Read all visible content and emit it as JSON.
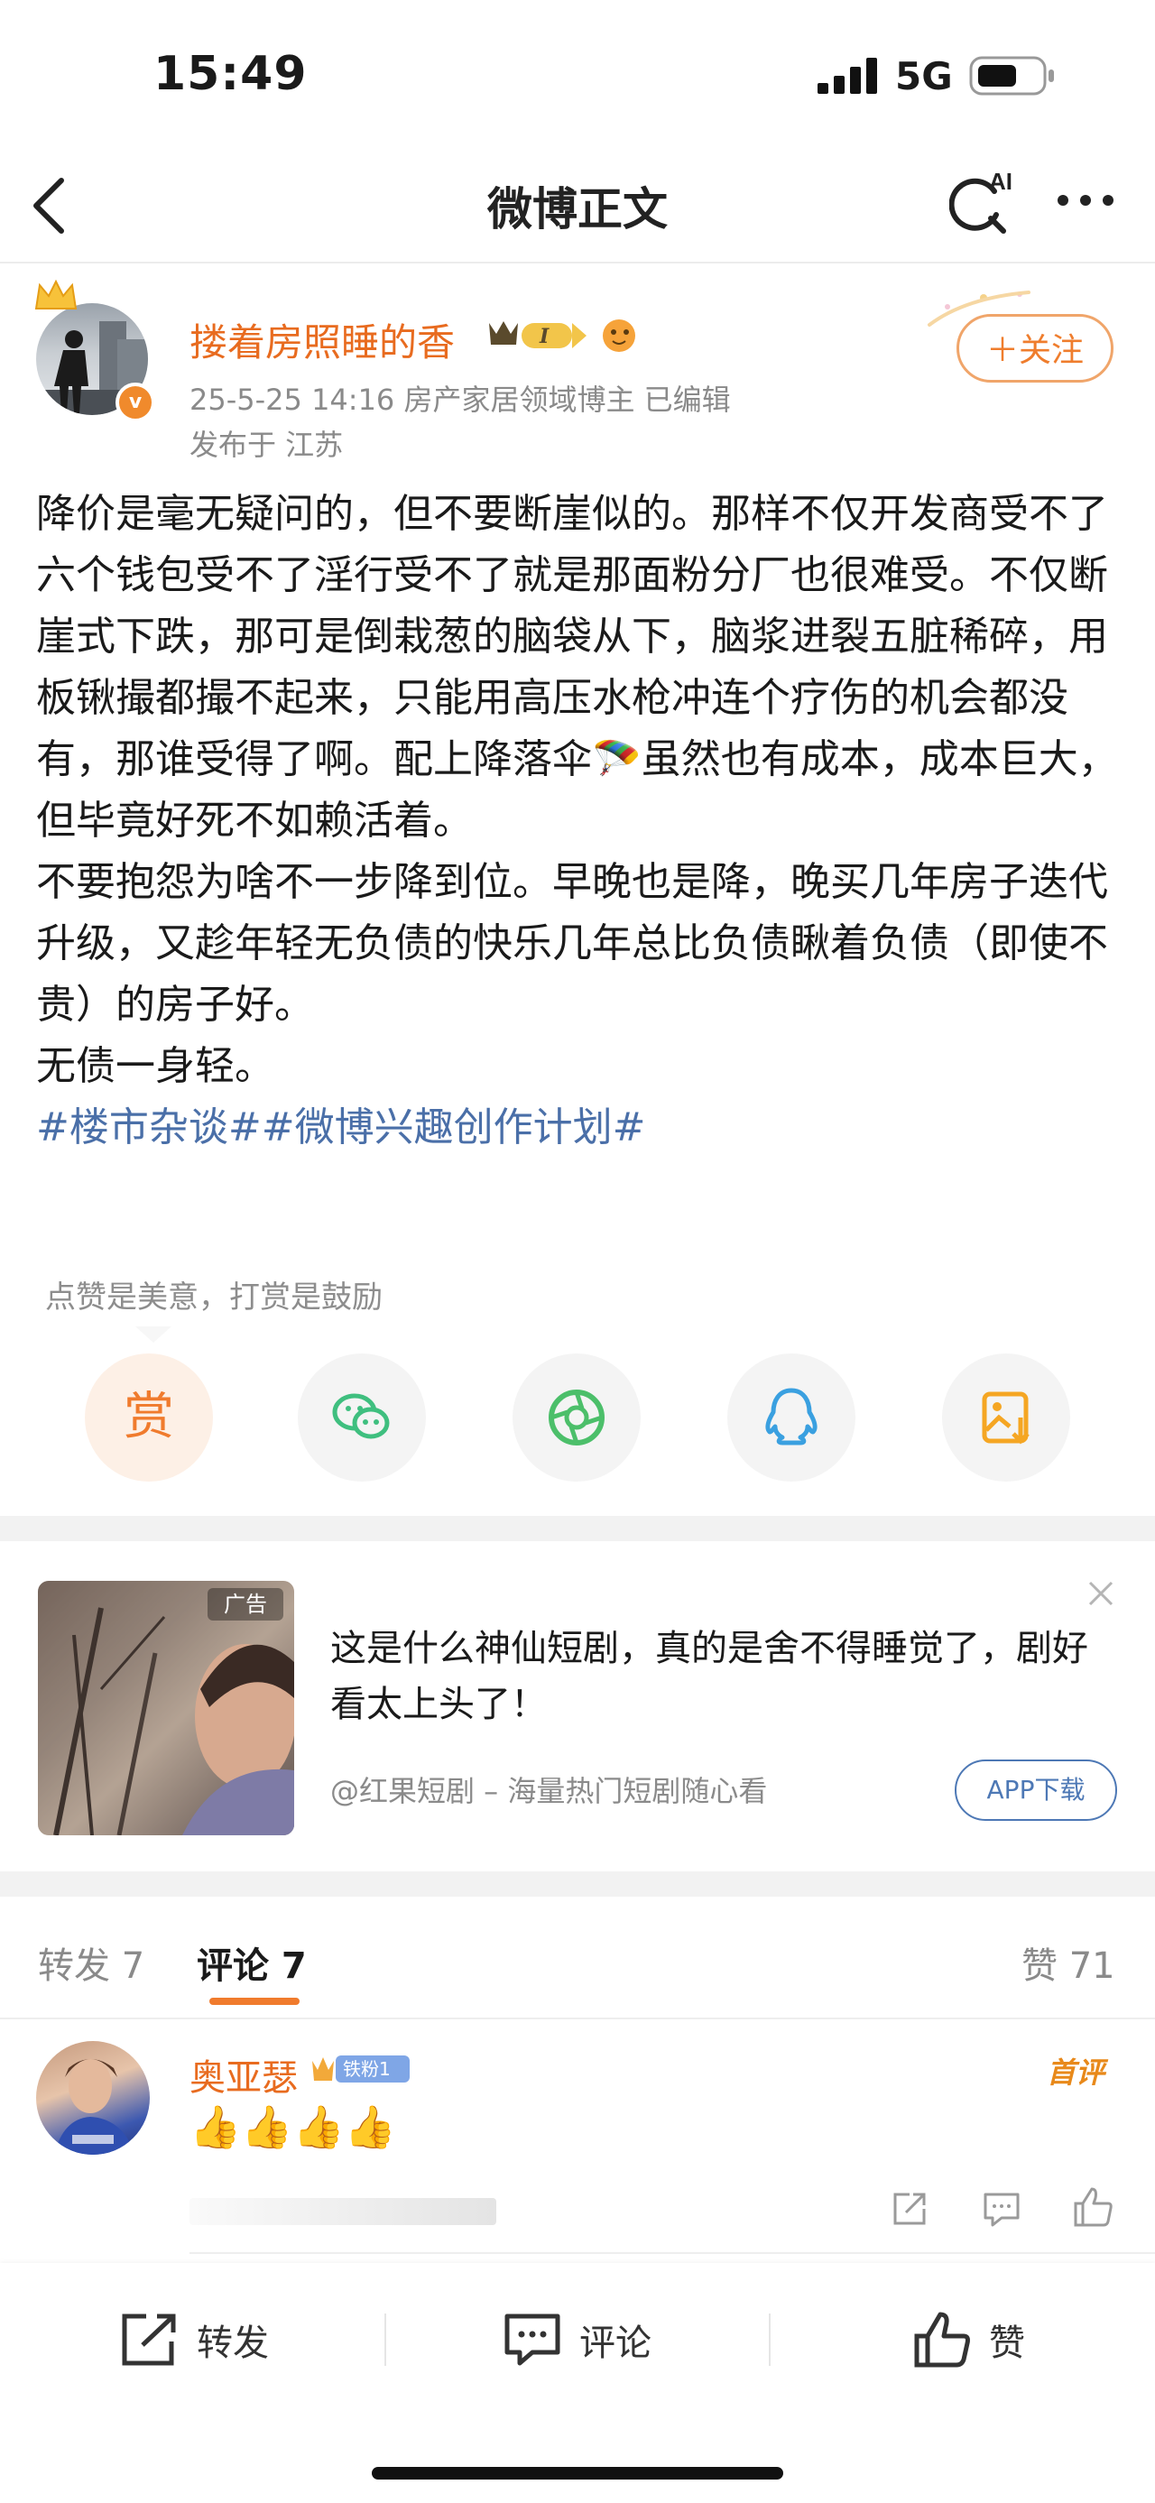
{
  "status_bar": {
    "time": "15:49",
    "network": "5G"
  },
  "nav": {
    "title": "微博正文",
    "ai_label": "AI"
  },
  "author": {
    "name": "搂着房照睡的香",
    "vip_level": "I",
    "meta": "25-5-25 14:16  房产家居领域博主  已编辑",
    "location": "发布于 江苏",
    "verified_mark": "v"
  },
  "follow_button": "＋关注",
  "post": {
    "paragraphs": [
      "降价是毫无疑问的，但不要断崖似的。那样不仅开发商受不了六个钱包受不了淫行受不了就是那面粉分厂也很难受。不仅断崖式下跌，那可是倒栽葱的脑袋从下，脑浆进裂五脏稀碎，用板锹撮都撮不起来，只能用高压水枪冲连个疗伤的机会都没有，那谁受得了啊。配上降落伞🪂虽然也有成本，成本巨大，但毕竟好死不如赖活着。",
      "不要抱怨为啥不一步降到位。早晚也是降，晚买几年房子迭代升级，又趁年轻无负债的快乐几年总比负债瞅着负债（即使不贵）的房子好。",
      "无债一身轻。"
    ],
    "topics": "#楼市杂谈##微博兴趣创作计划#"
  },
  "reward_hint": "点赞是美意，打赏是鼓励",
  "share_row": {
    "reward_label": "赏",
    "icons": [
      "wechat-icon",
      "moments-icon",
      "qq-icon",
      "save-image-icon"
    ],
    "colors": {
      "reward": "#f07b2d",
      "wechat": "#3fbf7f",
      "moments": "#4cbf6a",
      "qq": "#3aa0e0",
      "save": "#f5a623"
    }
  },
  "ad": {
    "tag": "广告",
    "text": "这是什么神仙短剧，真的是舍不得睡觉了，剧好看太上头了！",
    "source": "@红果短剧 – 海量热门短剧随心看",
    "download": "APP下载"
  },
  "tabs": {
    "repost": "转发 7",
    "comment": "评论 7",
    "like": "赞 71"
  },
  "comment": {
    "name": "奥亚瑟",
    "badge": "铁粉1",
    "top_label": "首评",
    "body": "👍👍👍👍"
  },
  "bottom_bar": {
    "repost": "转发",
    "comment": "评论",
    "like": "赞"
  },
  "accent_color": "#f07b2d",
  "topic_color": "#4a6fa8"
}
